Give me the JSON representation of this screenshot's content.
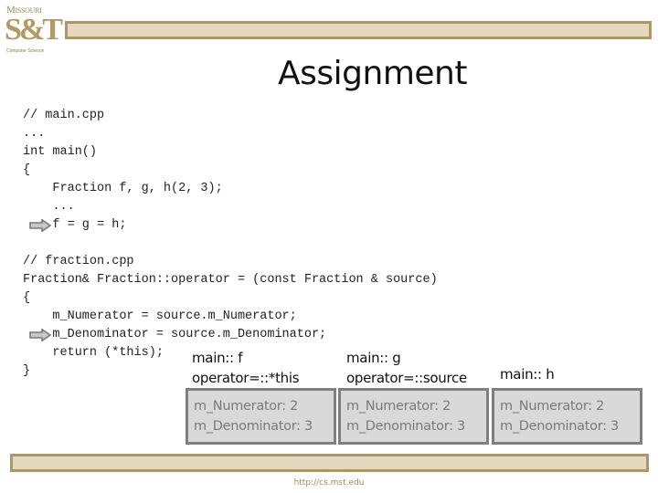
{
  "header": {
    "logo": {
      "top_text": "Missouri",
      "main_text": "S&T",
      "sub_text": "Computer Science"
    }
  },
  "slide": {
    "title": "Assignment",
    "code": {
      "main_cpp": [
        "// main.cpp",
        "...",
        "int main()",
        "{",
        "    Fraction f, g, h(2, 3);",
        "    ...",
        "    f = g = h;"
      ],
      "fraction_cpp": [
        "// fraction.cpp",
        "Fraction& Fraction::operator = (const Fraction & source)",
        "{",
        "    m_Numerator = source.m_Numerator;",
        "    m_Denominator = source.m_Denominator;",
        "    return (*this);",
        "}"
      ]
    },
    "arrows": [
      {
        "icon": "arrow-right-icon",
        "points_to": "f = g = h;"
      },
      {
        "icon": "arrow-right-icon",
        "points_to": "m_Denominator = source.m_Denominator;"
      }
    ],
    "variables": [
      {
        "name": "main:: f",
        "alias": "operator=::*this",
        "fields": [
          "m_Numerator: 2",
          "m_Denominator: 3"
        ]
      },
      {
        "name": "main:: g",
        "alias": "operator=::source",
        "fields": [
          "m_Numerator: 2",
          "m_Denominator: 3"
        ]
      },
      {
        "name": "main:: h",
        "alias": "",
        "fields": [
          "m_Numerator: 2",
          "m_Denominator: 3"
        ]
      }
    ]
  },
  "footer": {
    "url": "http://cs.mst.edu"
  },
  "colors": {
    "bar_fill": "#e4d8bf",
    "bar_border": "#ae9766",
    "box_fill": "#d9d9d9",
    "box_border": "#7f7f7f",
    "box_text": "#7a7a7a",
    "footer_text": "#9c8a5c"
  }
}
